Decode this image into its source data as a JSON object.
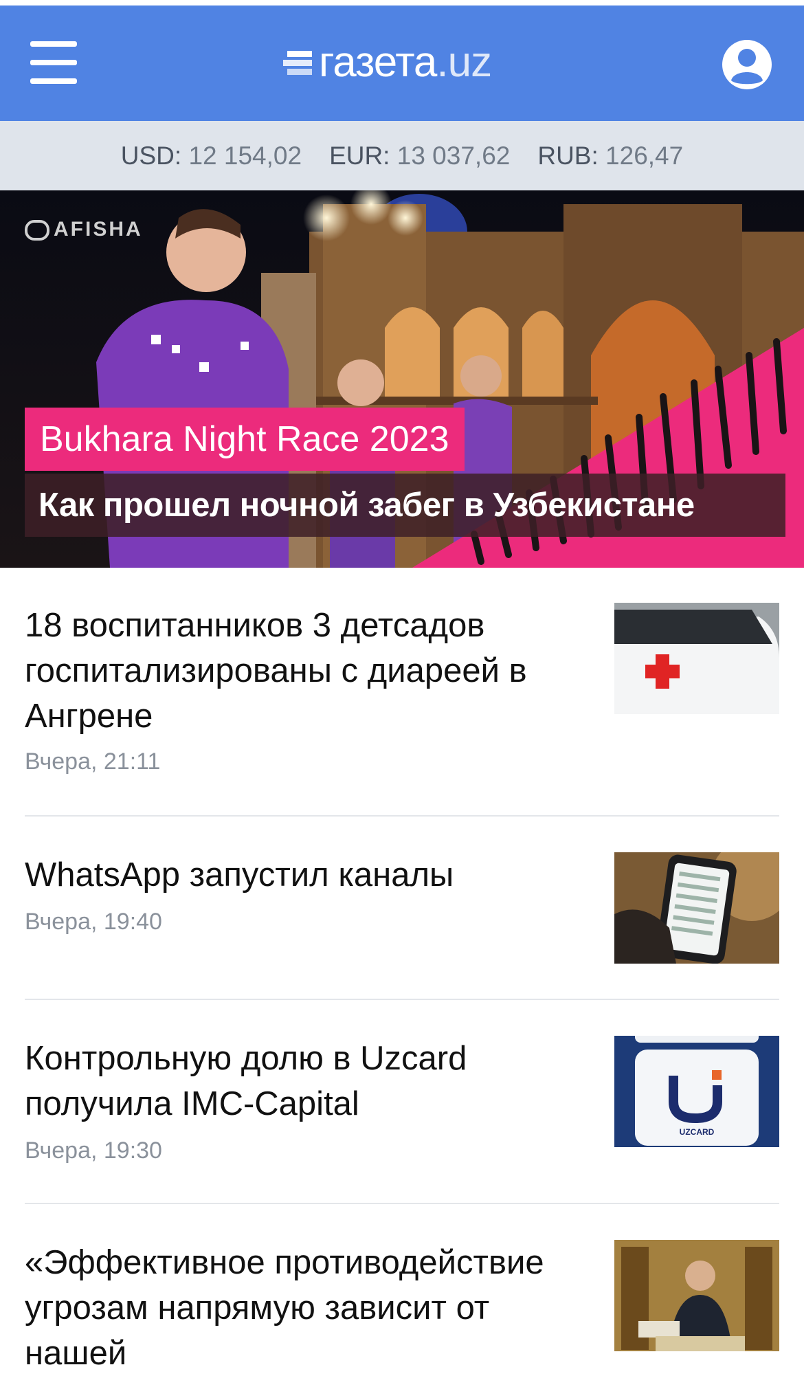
{
  "header": {
    "logo_main": "газета",
    "logo_suffix": ".uz"
  },
  "rates": [
    {
      "label": "USD:",
      "value": "12 154,02"
    },
    {
      "label": "EUR:",
      "value": "13 037,62"
    },
    {
      "label": "RUB:",
      "value": "126,47"
    }
  ],
  "banner": {
    "brand": "AFISHA",
    "tag": "Bukhara Night Race 2023",
    "title": "Как прошел ночной забег в Узбекистане"
  },
  "news": [
    {
      "title": "18 воспитанников 3 детсадов госпитализированы с диареей в Ангрене",
      "time": "Вчера, 21:11"
    },
    {
      "title": "WhatsApp запустил каналы",
      "time": "Вчера, 19:40"
    },
    {
      "title": "Контрольную долю в Uzcard получила IMC-Capital",
      "time": "Вчера, 19:30"
    },
    {
      "title": "«Эффективное противодействие угрозам напрямую зависит от нашей",
      "time": ""
    }
  ],
  "thumbnails": {
    "uzcard_label": "UZCARD"
  },
  "colors": {
    "header_bg": "#5083e3",
    "rates_bg": "#dfe4eb",
    "accent_pink": "#ec2b7c"
  }
}
